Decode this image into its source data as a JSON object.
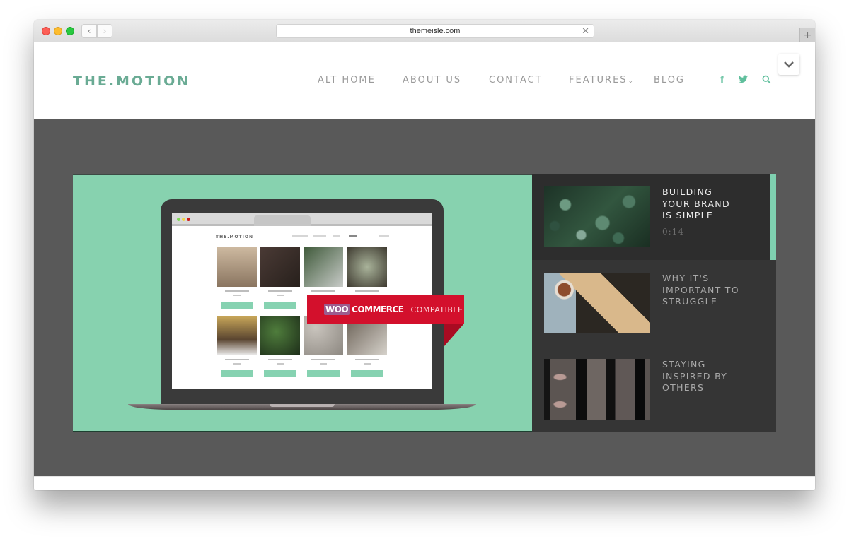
{
  "browser": {
    "url": "themeisle.com",
    "back_icon": "chevron-left-icon",
    "forward_icon": "chevron-right-icon",
    "close_icon": "close-icon",
    "new_tab_icon": "plus-icon"
  },
  "site": {
    "logo": "THE.MOTION",
    "nav": [
      {
        "label": "ALT HOME"
      },
      {
        "label": "ABOUT US"
      },
      {
        "label": "CONTACT"
      },
      {
        "label": "FEATURES",
        "has_dropdown": true
      },
      {
        "label": "BLOG"
      }
    ],
    "social": [
      {
        "icon": "facebook-icon",
        "glyph": "f"
      },
      {
        "icon": "twitter-icon",
        "glyph": "🐦"
      },
      {
        "icon": "search-icon",
        "glyph": "⌕"
      }
    ],
    "accent_color": "#6aab94"
  },
  "hero": {
    "main_slide": {
      "mockup_logo": "THE.MOTION",
      "ribbon": {
        "woo": "WOO",
        "commerce": "COMMERCE",
        "compatible": "COMPATIBLE"
      }
    },
    "side_items": [
      {
        "title": "BUILDING YOUR BRAND IS SIMPLE",
        "time": "0:14",
        "active": true
      },
      {
        "title": "WHY IT'S IMPORTANT TO STRUGGLE",
        "active": false
      },
      {
        "title": "STAYING INSPIRED BY OTHERS",
        "active": false
      }
    ]
  }
}
